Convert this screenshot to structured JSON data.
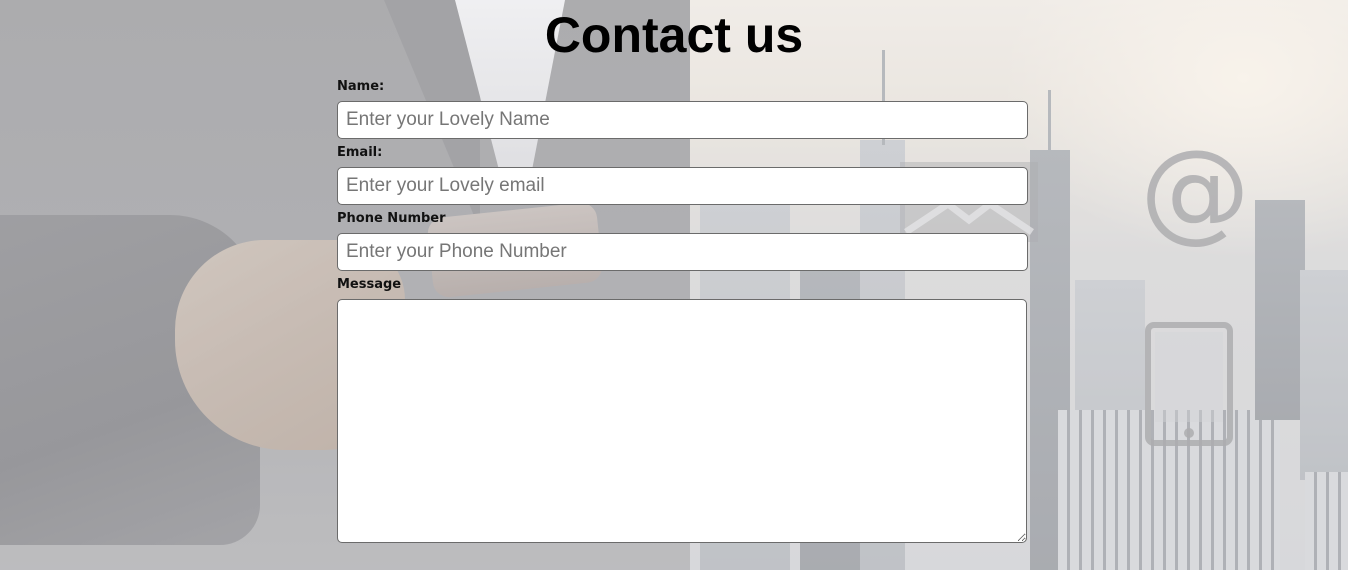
{
  "page": {
    "title": "Contact us"
  },
  "form": {
    "name": {
      "label": "Name:",
      "placeholder": "Enter your Lovely Name",
      "value": ""
    },
    "email": {
      "label": "Email:",
      "placeholder": "Enter your Lovely email",
      "value": ""
    },
    "phone": {
      "label": "Phone Number",
      "placeholder": "Enter your Phone Number",
      "value": ""
    },
    "message": {
      "label": "Message",
      "value": ""
    }
  },
  "background": {
    "icons": [
      "at-sign-icon",
      "envelope-icon",
      "smartphone-icon"
    ],
    "icon_color": "#8d8d8f",
    "at_glyph": "@"
  }
}
